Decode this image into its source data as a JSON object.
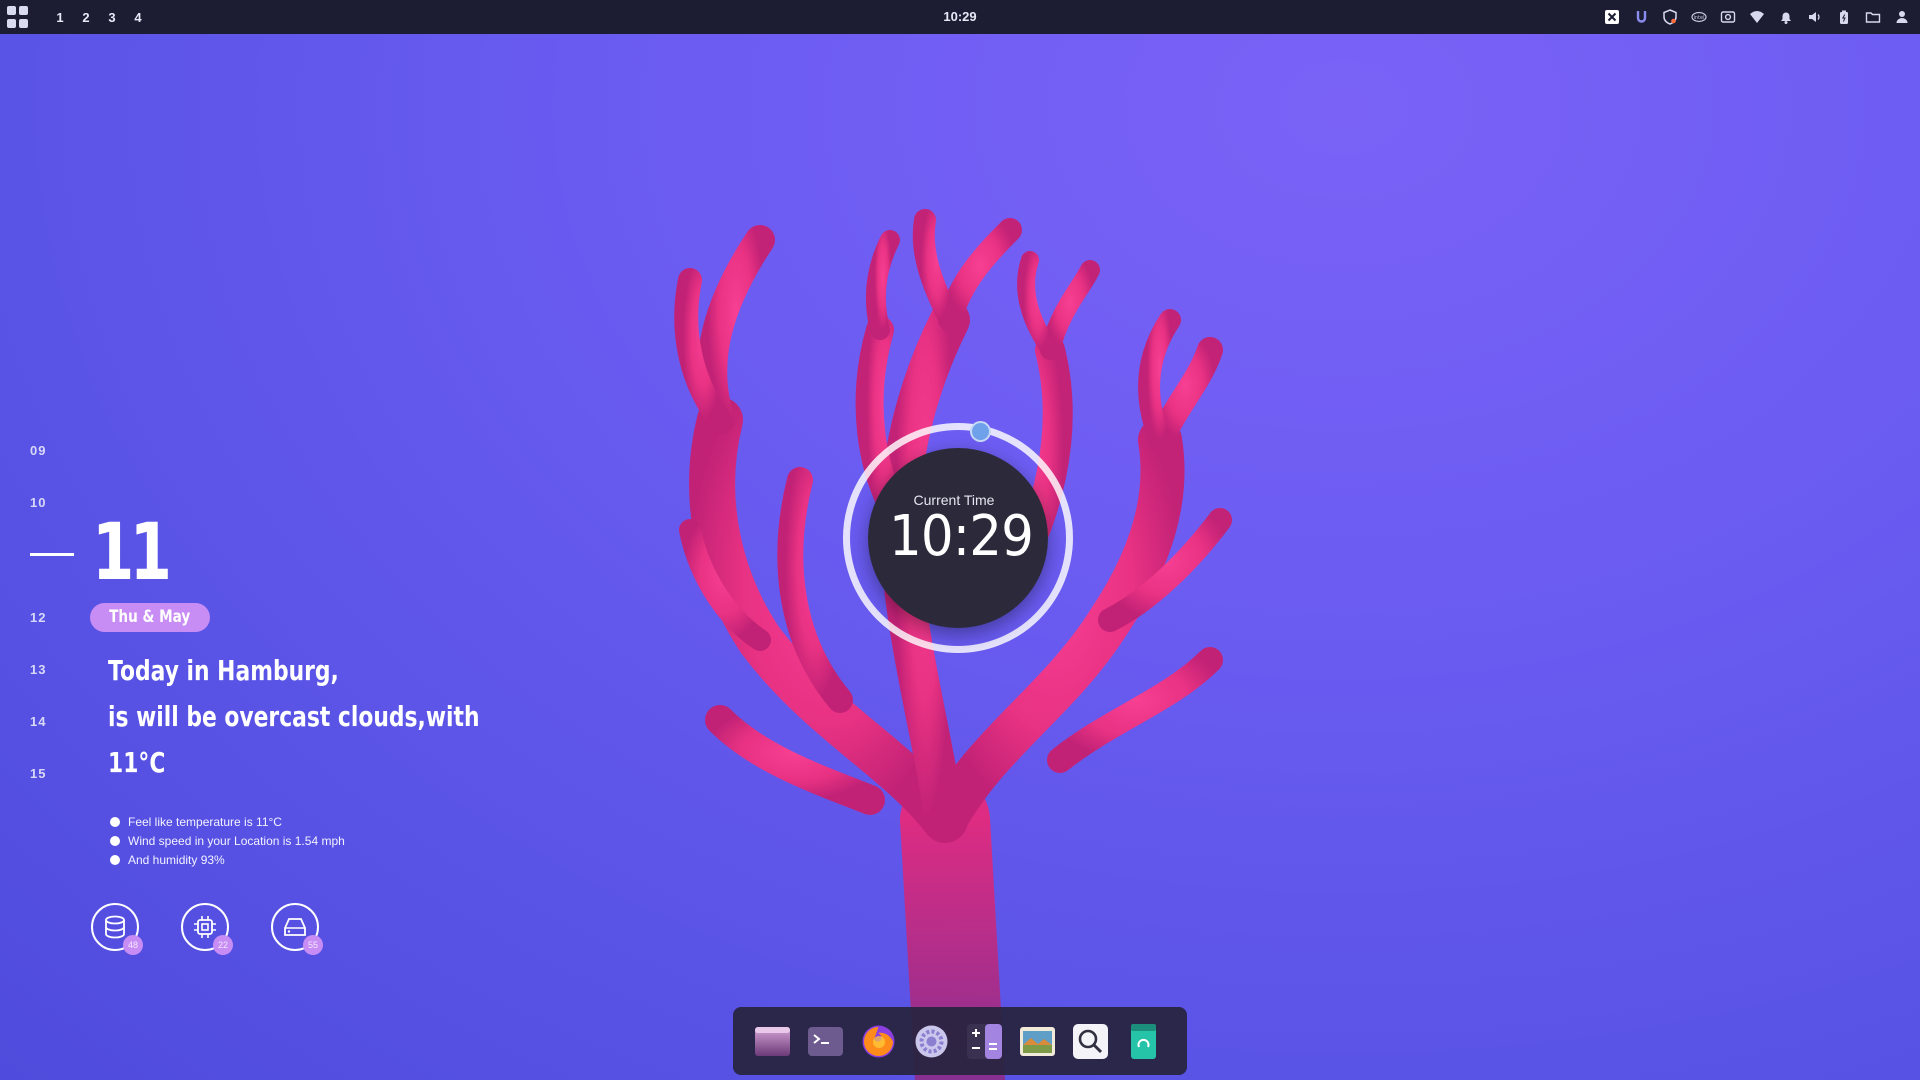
{
  "topbar": {
    "workspaces": [
      "1",
      "2",
      "3",
      "4"
    ],
    "clock": "10:29",
    "tray_icons": [
      "x-app-icon",
      "u-app-icon",
      "shield-icon",
      "intel-icon",
      "screenshot-icon",
      "wifi-icon",
      "bell-icon",
      "volume-icon",
      "battery-icon",
      "folder-icon",
      "user-icon"
    ]
  },
  "timeline": {
    "hours_before": [
      "09",
      "10"
    ],
    "current_hour": "11",
    "hours_after": [
      "12",
      "13",
      "14",
      "15"
    ],
    "date_label": "Thu & May"
  },
  "weather": {
    "line1": "Today in Hamburg,",
    "line2": "is will be overcast clouds,with",
    "line3": "11°C",
    "details": [
      "Feel like temperature is 11°C",
      "Wind speed in your Location is 1.54 mph",
      "And humidity 93%"
    ]
  },
  "stats": [
    {
      "icon": "database-icon",
      "value": "48"
    },
    {
      "icon": "cpu-icon",
      "value": "22"
    },
    {
      "icon": "drive-icon",
      "value": "55"
    }
  ],
  "clock_widget": {
    "label": "Current Time",
    "time": "10:29"
  },
  "dock": {
    "apps": [
      "file-manager-icon",
      "terminal-icon",
      "firefox-icon",
      "settings-icon",
      "calculator-icon",
      "image-viewer-icon",
      "search-icon",
      "trash-icon"
    ]
  },
  "colors": {
    "background": "#6c5cf2",
    "topbar": "#1c1d33",
    "accent_pill": "#c88df4",
    "clock_knob": "#6fa0ea"
  }
}
